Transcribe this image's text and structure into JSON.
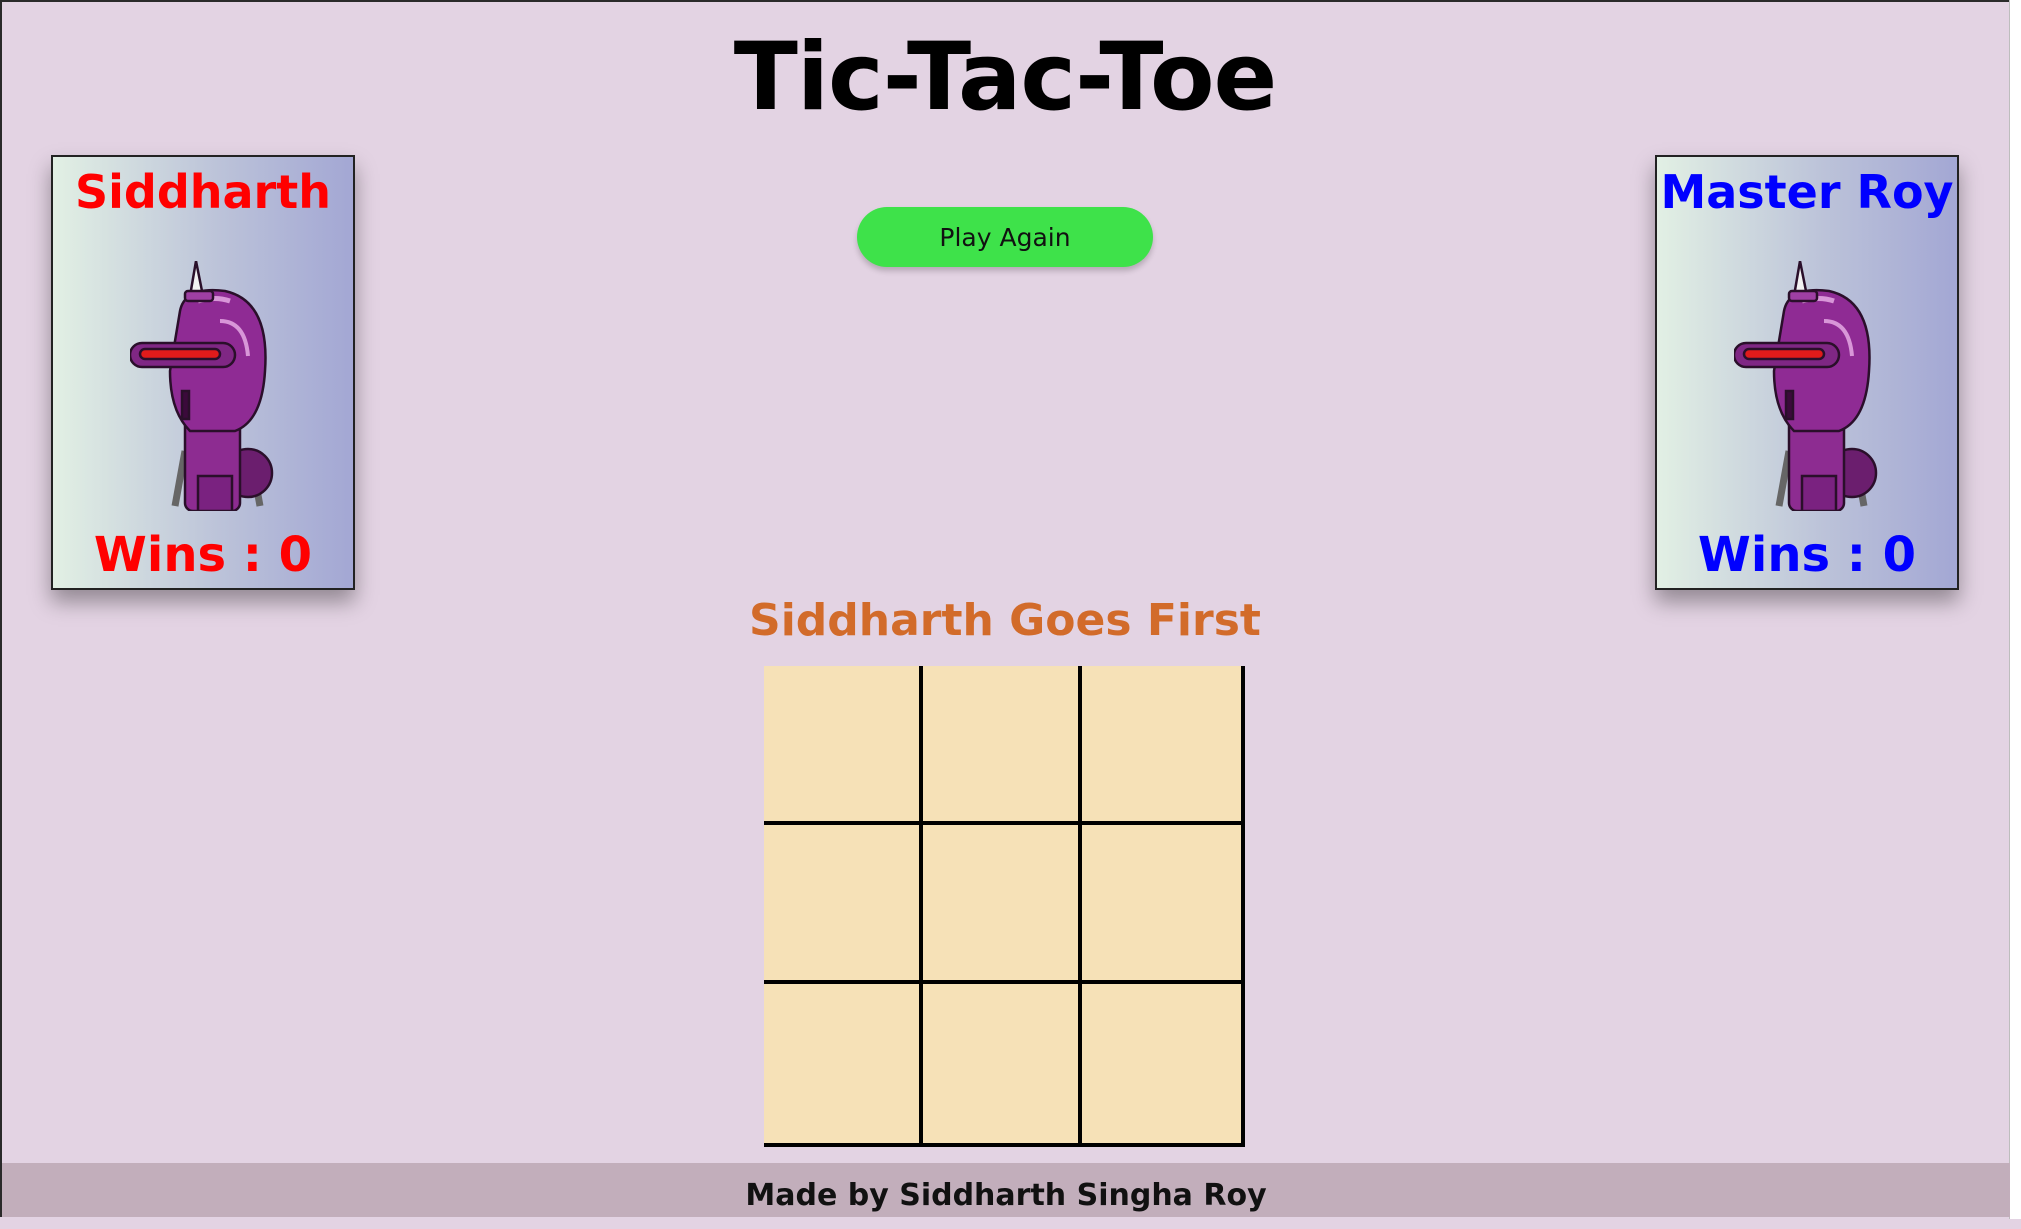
{
  "title": "Tic-Tac-Toe",
  "controls": {
    "play_again_label": "Play Again"
  },
  "players": [
    {
      "name": "Siddharth",
      "wins_text": "Wins : 0",
      "color": "#ff0000",
      "avatar_icon": "purple-robot-avatar"
    },
    {
      "name": "Master Roy",
      "wins_text": "Wins : 0",
      "color": "#0000ff",
      "avatar_icon": "purple-robot-avatar"
    }
  ],
  "status_text": "Siddharth Goes First",
  "status_color": "#d26b2a",
  "board": {
    "cells": [
      "",
      "",
      "",
      "",
      "",
      "",
      "",
      "",
      ""
    ]
  },
  "footer": {
    "credit": "Made by Siddharth Singha Roy"
  },
  "colors": {
    "background": "#e3d3e3",
    "board_fill": "#f6e1b7",
    "play_again_bg": "#3ee24a",
    "footer_bg": "#c2aebb"
  }
}
